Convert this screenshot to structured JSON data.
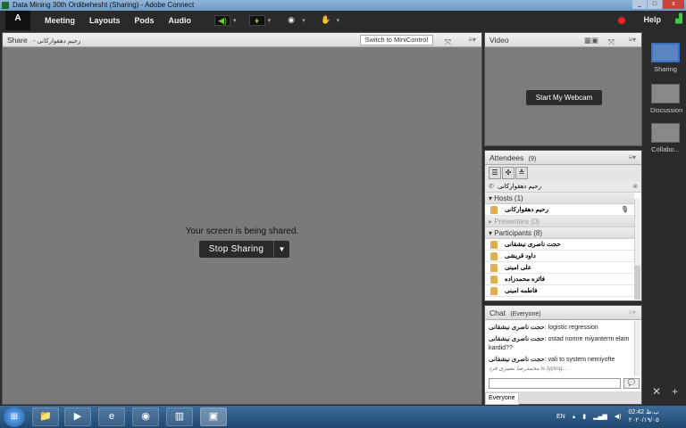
{
  "window": {
    "title": "Data Mining 30th Ordibehesht (Sharing) - Adobe Connect",
    "minimize": "_",
    "maximize": "□",
    "close": "x"
  },
  "menubar": {
    "logo": "Adobe",
    "items": [
      "Meeting",
      "Layouts",
      "Pods",
      "Audio"
    ],
    "help": "Help",
    "tools": [
      "speaker-icon",
      "microphone-icon",
      "webcam-icon",
      "raise-hand-icon"
    ]
  },
  "share": {
    "title": "Share",
    "presenter": "- رحیم دهقوارکانی",
    "switch_label": "Switch to MiniControl",
    "message": "Your screen is being shared.",
    "stop_label": "Stop Sharing"
  },
  "video": {
    "title": "Video",
    "webcam_label": "Start My Webcam"
  },
  "attendees": {
    "title": "Attendees",
    "count": "(9)",
    "me": "رحیم دهقوارکانی",
    "hosts": {
      "label": "Hosts (1)",
      "items": [
        "رحیم دهقوارکانی"
      ]
    },
    "presenters": {
      "label": "Presenters (0)"
    },
    "participants": {
      "label": "Participants (8)",
      "items": [
        "حجت ناصری نیشقانی",
        "داود قریشی",
        "علی امینی",
        "فائزه محمدزاده",
        "فاطمه امینی"
      ]
    }
  },
  "chat": {
    "title": "Chat",
    "scope": "(Everyone)",
    "messages": [
      {
        "sender": "حجت ناصری نیشقانی",
        "text": ": logistic regression"
      },
      {
        "sender": "حجت ناصری نیشقانی",
        "text": ": ostad nomre miyanterm elam kardid??"
      },
      {
        "sender": "حجت ناصری نیشقانی",
        "text": ": vali to system nemiyofte"
      }
    ],
    "typing": "محمدرضا نصیری فرد is typing...",
    "input_value": "",
    "tab": "Everyone"
  },
  "layouts": [
    {
      "label": "Sharing",
      "selected": true
    },
    {
      "label": "Discussion",
      "selected": false
    },
    {
      "label": "Collabo...",
      "selected": false
    }
  ],
  "taskbar": {
    "lang": "EN",
    "time": "02:42 ب.ظ",
    "date": "۲۰۲۰/۱۹/۰۵"
  }
}
